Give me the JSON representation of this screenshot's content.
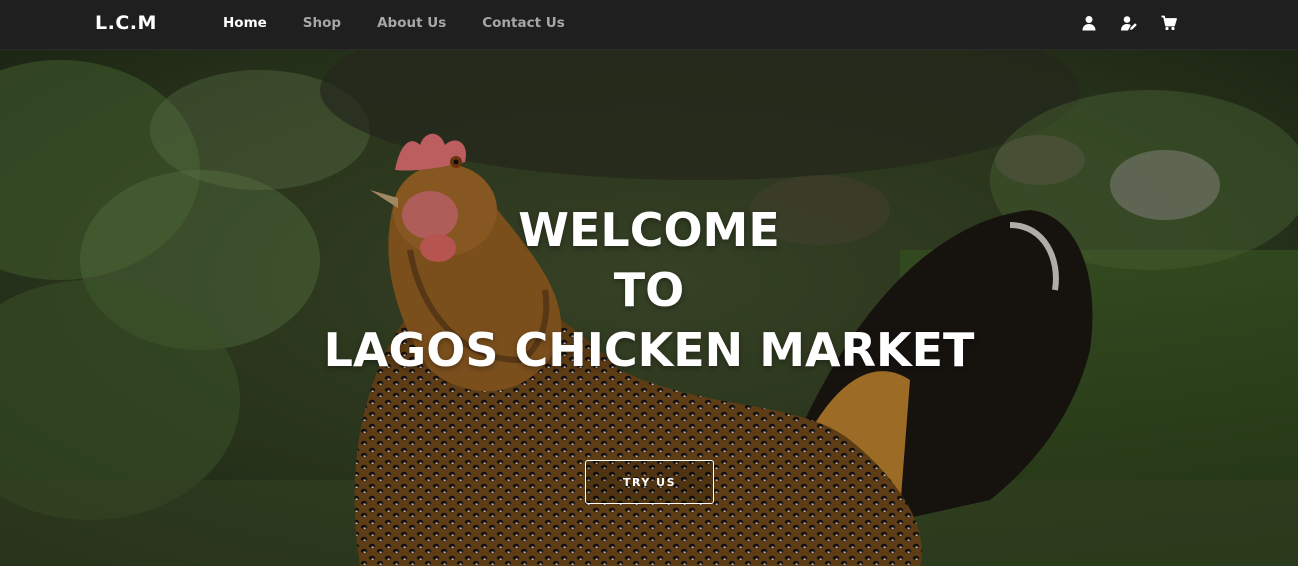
{
  "nav": {
    "brand": "L.C.M",
    "links": [
      {
        "label": "Home",
        "active": true
      },
      {
        "label": "Shop",
        "active": false
      },
      {
        "label": "About Us",
        "active": false
      },
      {
        "label": "Contact Us",
        "active": false
      }
    ],
    "icons": [
      "user-icon",
      "user-edit-icon",
      "cart-icon"
    ]
  },
  "hero": {
    "title_lines": [
      "WELCOME",
      "TO",
      "LAGOS CHICKEN MARKET"
    ],
    "cta_label": "TRY US",
    "background": "hen-in-grass-photo"
  },
  "colors": {
    "navbar_bg": "#1f1f1f",
    "nav_active": "#ffffff",
    "nav_inactive": "#a7a7a7",
    "hero_text": "#ffffff"
  }
}
